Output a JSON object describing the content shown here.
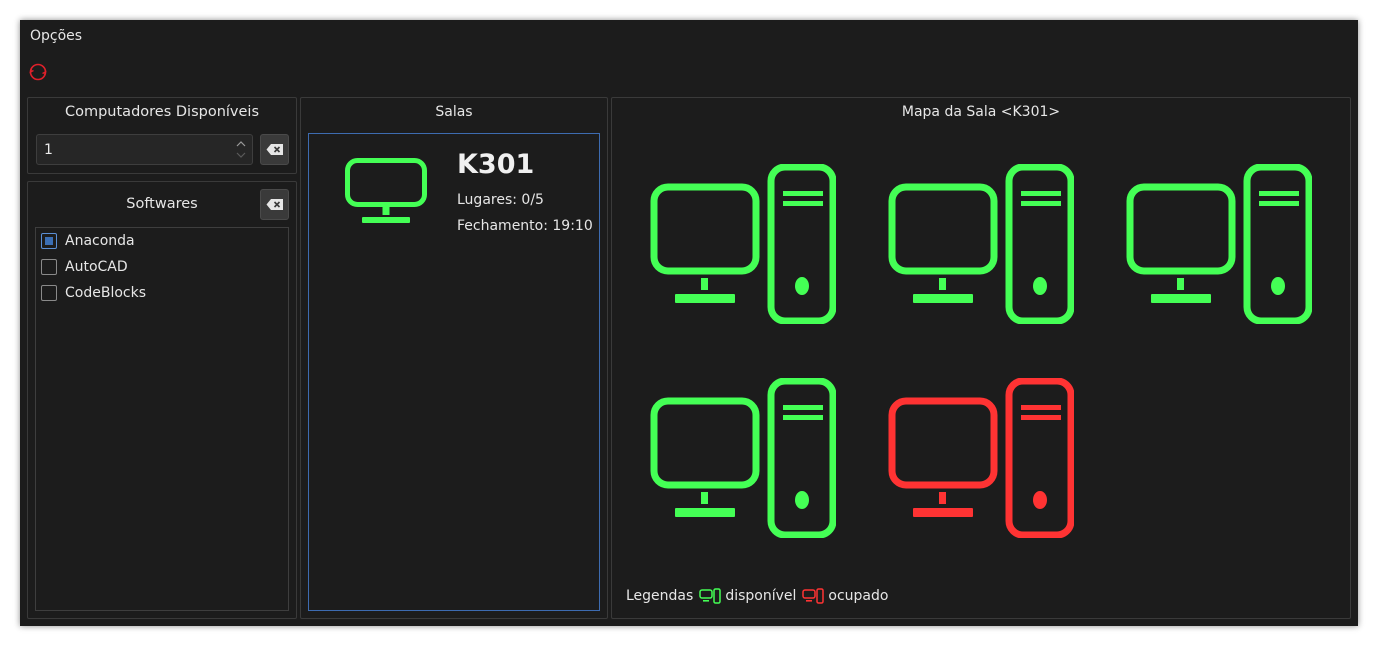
{
  "menu": {
    "options_label": "Opções"
  },
  "colors": {
    "available": "#44ff55",
    "occupied": "#ff3333",
    "accent": "#3d6bb0"
  },
  "computers_panel": {
    "title": "Computadores Disponíveis",
    "value": "1"
  },
  "softwares_panel": {
    "title": "Softwares",
    "items": [
      {
        "label": "Anaconda",
        "checked": true
      },
      {
        "label": "AutoCAD",
        "checked": false
      },
      {
        "label": "CodeBlocks",
        "checked": false
      }
    ]
  },
  "rooms_panel": {
    "title": "Salas",
    "rooms": [
      {
        "name": "K301",
        "seats": "Lugares: 0/5",
        "closing": "Fechamento: 19:10"
      }
    ]
  },
  "map_panel": {
    "title": "Mapa da Sala <K301>",
    "computers": [
      {
        "status": "available"
      },
      {
        "status": "available"
      },
      {
        "status": "available"
      },
      {
        "status": "available"
      },
      {
        "status": "occupied"
      }
    ],
    "legend": {
      "label": "Legendas",
      "available": "disponível",
      "occupied": "ocupado"
    }
  }
}
